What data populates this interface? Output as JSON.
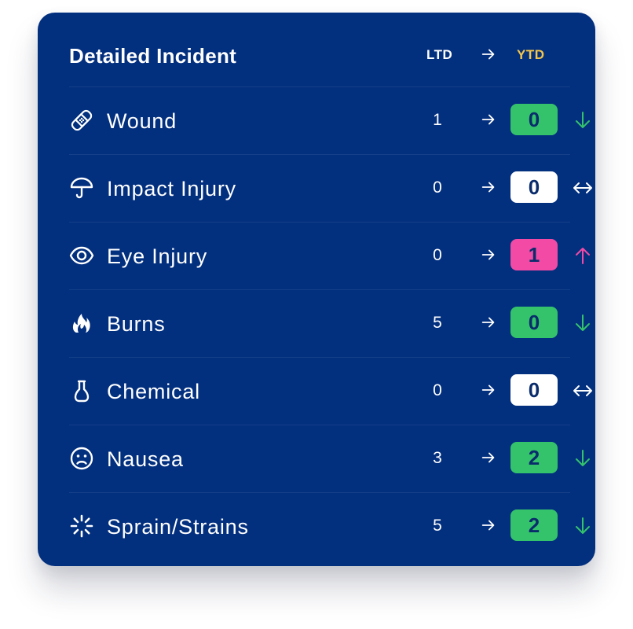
{
  "panel": {
    "title": "Detailed Incident",
    "ltd_label": "LTD",
    "ytd_label": "YTD"
  },
  "colors": {
    "background": "#022f7e",
    "ytd": "#f4c64a",
    "decrease": "#34c36b",
    "increase": "#f24aa5",
    "neutral": "#ffffff"
  },
  "rows": [
    {
      "icon": "bandage-icon",
      "label": "Wound",
      "ltd": "1",
      "ytd": "0",
      "trend": "down"
    },
    {
      "icon": "umbrella-icon",
      "label": "Impact Injury",
      "ltd": "0",
      "ytd": "0",
      "trend": "flat"
    },
    {
      "icon": "eye-icon",
      "label": "Eye Injury",
      "ltd": "0",
      "ytd": "1",
      "trend": "up"
    },
    {
      "icon": "flame-icon",
      "label": "Burns",
      "ltd": "5",
      "ytd": "0",
      "trend": "down"
    },
    {
      "icon": "flask-icon",
      "label": "Chemical",
      "ltd": "0",
      "ytd": "0",
      "trend": "flat"
    },
    {
      "icon": "sad-face-icon",
      "label": "Nausea",
      "ltd": "3",
      "ytd": "2",
      "trend": "down"
    },
    {
      "icon": "loader-burst-icon",
      "label": "Sprain/Strains",
      "ltd": "5",
      "ytd": "2",
      "trend": "down"
    }
  ]
}
